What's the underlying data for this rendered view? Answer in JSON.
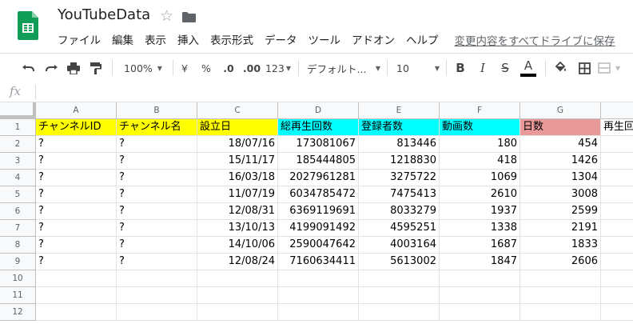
{
  "doc": {
    "title": "YouTubeData"
  },
  "menu": {
    "items": [
      "ファイル",
      "編集",
      "表示",
      "挿入",
      "表示形式",
      "データ",
      "ツール",
      "アドオン",
      "ヘルプ"
    ],
    "save_status": "変更内容をすべてドライブに保存"
  },
  "toolbar": {
    "zoom": "100%",
    "currency": "¥",
    "percent": "%",
    "dec_decrease": ".0",
    "dec_increase": ".00",
    "more_formats": "123",
    "font": "デフォルト...",
    "font_size": "10",
    "bold": "B",
    "italic": "I",
    "strike": "S",
    "text_color": "A",
    "text_color_value": "#000000"
  },
  "formula": {
    "label": "fx",
    "value": ""
  },
  "grid": {
    "columns": [
      "A",
      "B",
      "C",
      "D",
      "E",
      "F",
      "G"
    ],
    "header_row": [
      "チャンネルID",
      "チャンネル名",
      "設立日",
      "総再生回数",
      "登録者数",
      "動画数",
      "日数",
      "再生回"
    ],
    "row_numbers": [
      "1",
      "2",
      "3",
      "4",
      "5",
      "6",
      "7",
      "8",
      "9",
      "10",
      "11",
      "12"
    ],
    "data_rows": [
      [
        "?",
        "?",
        "18/07/16",
        "173081067",
        "813446",
        "180",
        "454"
      ],
      [
        "?",
        "?",
        "15/11/17",
        "185444805",
        "1218830",
        "418",
        "1426"
      ],
      [
        "?",
        "?",
        "16/03/18",
        "2027961281",
        "3275722",
        "1069",
        "1304"
      ],
      [
        "?",
        "?",
        "11/07/19",
        "6034785472",
        "7475413",
        "2610",
        "3008"
      ],
      [
        "?",
        "?",
        "12/08/31",
        "6369119691",
        "8033279",
        "1937",
        "2599"
      ],
      [
        "?",
        "?",
        "13/10/13",
        "4199091492",
        "4595251",
        "1338",
        "2191"
      ],
      [
        "?",
        "?",
        "14/10/06",
        "2590047642",
        "4003164",
        "1687",
        "1833"
      ],
      [
        "?",
        "?",
        "12/08/24",
        "7160634411",
        "5613002",
        "1847",
        "2606"
      ]
    ],
    "colors": {
      "yellow": "#ffff00",
      "cyan": "#00ffff",
      "red": "#ea9999"
    }
  }
}
